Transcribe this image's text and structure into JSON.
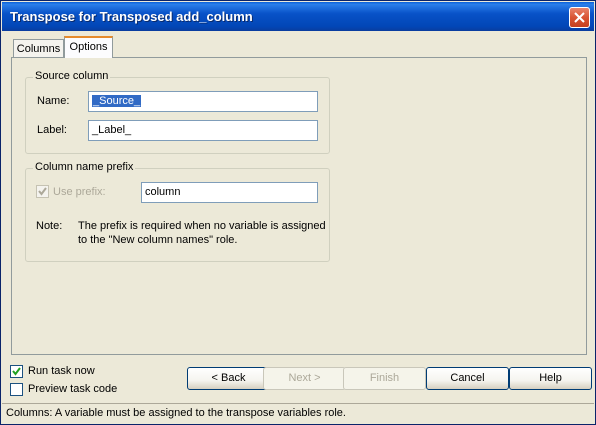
{
  "window": {
    "title": "Transpose for Transposed add_column"
  },
  "tabs": [
    {
      "label": "Columns"
    },
    {
      "label": "Options"
    }
  ],
  "source_column": {
    "group_title": "Source column",
    "name_label": "Name:",
    "name_value": "_Source_",
    "label_label": "Label:",
    "label_value": "_Label_"
  },
  "prefix": {
    "group_title": "Column name prefix",
    "use_prefix_label": "Use prefix:",
    "use_prefix_checked": true,
    "prefix_value": "column",
    "note_label": "Note:",
    "note_line1": "The prefix is required when no variable is assigned",
    "note_line2": "to the \"New column names\" role."
  },
  "footer": {
    "run_task_now": "Run task now",
    "run_task_now_checked": true,
    "preview_task_code": "Preview task code",
    "preview_task_code_checked": false
  },
  "buttons": {
    "back": "< Back",
    "next": "Next >",
    "finish": "Finish",
    "cancel": "Cancel",
    "help": "Help"
  },
  "status": {
    "message": "Columns: A variable must be assigned to the transpose variables role."
  },
  "colors": {
    "titlebar": "#0246b6",
    "close_button": "#d95433",
    "selection": "#316ac5"
  },
  "icons": {
    "close": "close-icon",
    "check": "checkmark-icon"
  }
}
